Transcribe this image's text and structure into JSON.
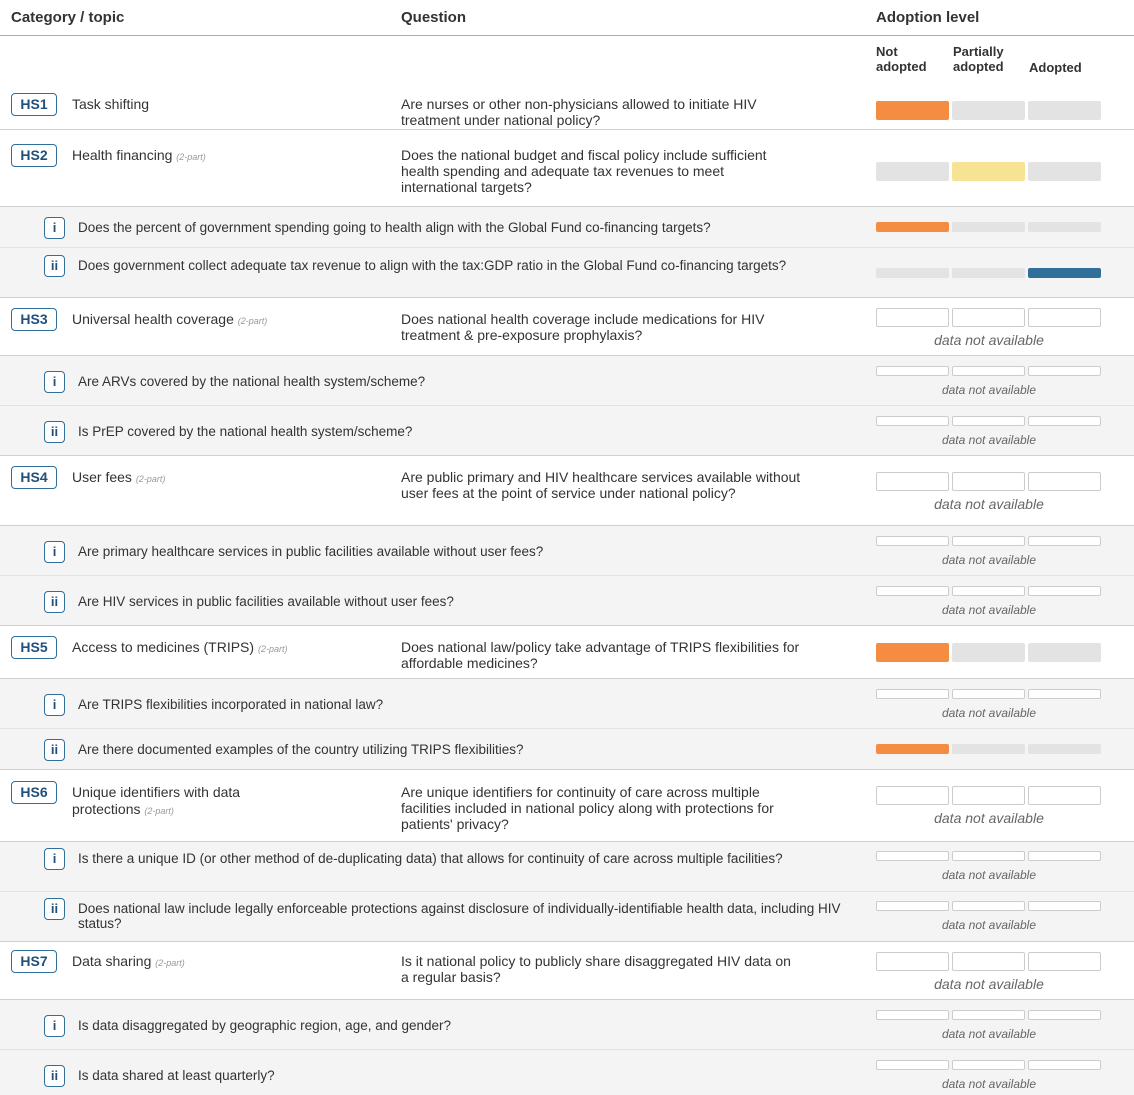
{
  "header": {
    "category": "Category / topic",
    "question": "Question",
    "adoption": "Adoption level",
    "levels": [
      "Not adopted",
      "Partially adopted",
      "Adopted"
    ]
  },
  "colors": {
    "not_adopted": "#f48c42",
    "partially_adopted": "#f6e394",
    "adopted": "#2f6f99",
    "neutral": "#e3e3e3"
  },
  "rows": [
    {
      "type": "main",
      "code": "HS1",
      "topic": "Task shifting",
      "part": "",
      "question": "Are nurses or other non-physicians allowed to initiate HIV treatment under national policy?",
      "level": "not_adopted",
      "status_text": ""
    },
    {
      "type": "main",
      "code": "HS2",
      "topic": "Health financing",
      "part": "(2-part)",
      "question": "Does the national budget and fiscal policy include sufficient health spending and adequate tax revenues to meet international targets?",
      "level": "partially_adopted",
      "status_text": ""
    },
    {
      "type": "sub",
      "code": "i",
      "question": "Does the percent of government spending going to health align with the Global Fund co-financing targets?",
      "level": "not_adopted",
      "status_text": ""
    },
    {
      "type": "sub",
      "code": "ii",
      "question": "Does government collect adequate tax revenue to align with the tax:GDP ratio in the Global Fund co-financing targets?",
      "level": "adopted",
      "status_text": ""
    },
    {
      "type": "main",
      "code": "HS3",
      "topic": "Universal health coverage",
      "part": "(2-part)",
      "question": "Does national health coverage include medications for HIV treatment & pre-exposure prophylaxis?",
      "level": "none",
      "status_text": "data not available"
    },
    {
      "type": "sub",
      "code": "i",
      "question": "Are ARVs covered by the national health system/scheme?",
      "level": "none",
      "status_text": "data not available"
    },
    {
      "type": "sub",
      "code": "ii",
      "question": "Is PrEP covered by the national health system/scheme?",
      "level": "none",
      "status_text": "data not available"
    },
    {
      "type": "main",
      "code": "HS4",
      "topic": "User fees",
      "part": "(2-part)",
      "question": "Are public primary and HIV healthcare services available without user fees at the point of service under national policy?",
      "level": "none",
      "status_text": "data not available"
    },
    {
      "type": "sub",
      "code": "i",
      "question": "Are primary healthcare services in public facilities available without user fees?",
      "level": "none",
      "status_text": "data not available"
    },
    {
      "type": "sub",
      "code": "ii",
      "question": "Are HIV services in public facilities available without user fees?",
      "level": "none",
      "status_text": "data not available"
    },
    {
      "type": "main",
      "code": "HS5",
      "topic": "Access to medicines (TRIPS)",
      "part": "(2-part)",
      "question": "Does national law/policy take advantage of TRIPS flexibilities for affordable medicines?",
      "level": "not_adopted",
      "status_text": ""
    },
    {
      "type": "sub",
      "code": "i",
      "question": "Are TRIPS flexibilities incorporated in national law?",
      "level": "none",
      "status_text": "data not available"
    },
    {
      "type": "sub",
      "code": "ii",
      "question": "Are there documented examples of the country utilizing TRIPS flexibilities?",
      "level": "not_adopted",
      "status_text": ""
    },
    {
      "type": "main",
      "code": "HS6",
      "topic": "Unique identifiers with data protections",
      "part": "(2-part)",
      "question": "Are unique identifiers for continuity of care across multiple facilities included in national policy along with protections for patients' privacy?",
      "level": "none",
      "status_text": "data not available"
    },
    {
      "type": "sub",
      "code": "i",
      "question": "Is there a unique ID (or other method of de-duplicating data) that allows for continuity of care across multiple facilities?",
      "level": "none",
      "status_text": "data not available"
    },
    {
      "type": "sub",
      "code": "ii",
      "question": "Does national law include legally enforceable protections against disclosure of individually-identifiable health data, including HIV status?",
      "level": "none",
      "status_text": "data not available"
    },
    {
      "type": "main",
      "code": "HS7",
      "topic": "Data sharing",
      "part": "(2-part)",
      "question": "Is it national policy to publicly share disaggregated HIV data on a regular basis?",
      "level": "none",
      "status_text": "data not available"
    },
    {
      "type": "sub",
      "code": "i",
      "question": "Is data disaggregated by geographic region, age, and gender?",
      "level": "none",
      "status_text": "data not available"
    },
    {
      "type": "sub",
      "code": "ii",
      "question": "Is data shared at least quarterly?",
      "level": "none",
      "status_text": "data not available"
    }
  ]
}
